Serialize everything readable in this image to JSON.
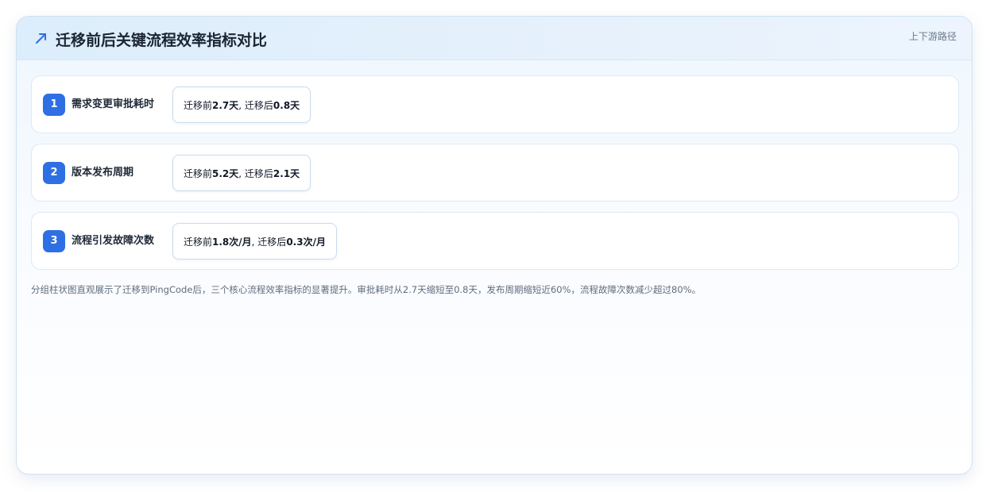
{
  "header": {
    "title": "迁移前后关键流程效率指标对比",
    "tag": "上下游路径",
    "icon": "trend-arrow-icon",
    "accent_color": "#2f6fe4"
  },
  "metrics": [
    {
      "index": "1",
      "label": "需求变更审批耗时",
      "before_prefix": "迁移前 ",
      "before_value": "2.7天",
      "separator": ", 迁移后 ",
      "after_value": "0.8天"
    },
    {
      "index": "2",
      "label": "版本发布周期",
      "before_prefix": "迁移前 ",
      "before_value": "5.2天",
      "separator": ", 迁移后 ",
      "after_value": "2.1天"
    },
    {
      "index": "3",
      "label": "流程引发故障次数",
      "before_prefix": "迁移前 ",
      "before_value": "1.8次/月",
      "separator": ", 迁移后 ",
      "after_value": "0.3次/月"
    }
  ],
  "caption": "分组柱状图直观展示了迁移到PingCode后，三个核心流程效率指标的显著提升。审批耗时从2.7天缩短至0.8天，发布周期缩短近60%，流程故障次数减少超过80%。"
}
